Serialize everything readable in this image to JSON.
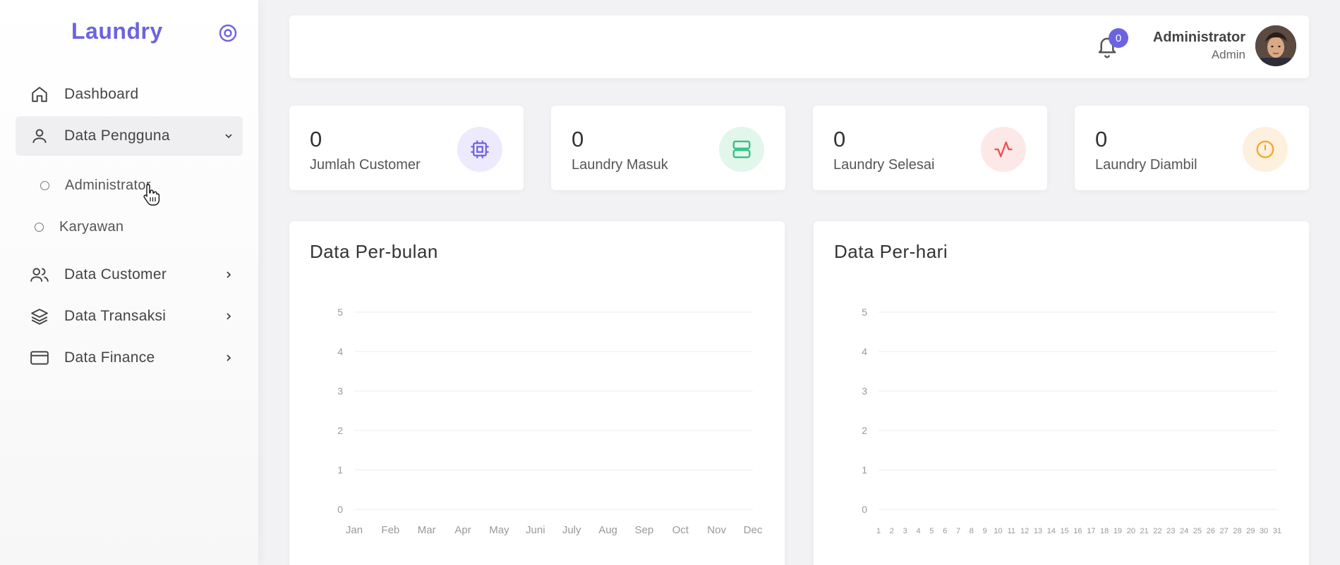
{
  "sidebar": {
    "brand": "Laundry",
    "items": [
      {
        "label": "Dashboard",
        "icon": "home-icon"
      },
      {
        "label": "Data Pengguna",
        "icon": "user-icon",
        "expanded": true,
        "children": [
          {
            "label": "Administrator"
          },
          {
            "label": "Karyawan"
          }
        ]
      },
      {
        "label": "Data Customer",
        "icon": "users-icon"
      },
      {
        "label": "Data Transaksi",
        "icon": "layers-icon"
      },
      {
        "label": "Data Finance",
        "icon": "credit-card-icon"
      }
    ]
  },
  "header": {
    "notification_count": "0",
    "user_name": "Administrator",
    "user_role": "Admin"
  },
  "stats": [
    {
      "value": "0",
      "label": "Jumlah Customer",
      "icon": "cpu-icon",
      "color": "#6c63e0",
      "bg": "#eeeafd"
    },
    {
      "value": "0",
      "label": "Laundry Masuk",
      "icon": "server-icon",
      "color": "#2bbf7e",
      "bg": "#e2f6ec"
    },
    {
      "value": "0",
      "label": "Laundry Selesai",
      "icon": "activity-icon",
      "color": "#ef4b4b",
      "bg": "#fde8e8"
    },
    {
      "value": "0",
      "label": "Laundry Diambil",
      "icon": "alert-circle-icon",
      "color": "#f5a623",
      "bg": "#fef0df"
    }
  ],
  "chart_data": [
    {
      "type": "line",
      "title": "Data Per-bulan",
      "categories": [
        "Jan",
        "Feb",
        "Mar",
        "Apr",
        "May",
        "Juni",
        "July",
        "Aug",
        "Sep",
        "Oct",
        "Nov",
        "Dec"
      ],
      "series": [
        {
          "values": [
            0,
            0,
            0,
            0,
            0,
            0,
            0,
            0,
            0,
            0,
            0,
            0
          ]
        }
      ],
      "ylim": [
        0,
        5
      ],
      "yticks": [
        0,
        1,
        2,
        3,
        4,
        5
      ],
      "grid": true
    },
    {
      "type": "line",
      "title": "Data Per-hari",
      "categories": [
        "1",
        "2",
        "3",
        "4",
        "5",
        "6",
        "7",
        "8",
        "9",
        "10",
        "11",
        "12",
        "13",
        "14",
        "15",
        "16",
        "17",
        "18",
        "19",
        "20",
        "21",
        "22",
        "23",
        "24",
        "25",
        "26",
        "27",
        "28",
        "29",
        "30",
        "31"
      ],
      "series": [
        {
          "values": [
            0,
            0,
            0,
            0,
            0,
            0,
            0,
            0,
            0,
            0,
            0,
            0,
            0,
            0,
            0,
            0,
            0,
            0,
            0,
            0,
            0,
            0,
            0,
            0,
            0,
            0,
            0,
            0,
            0,
            0,
            0
          ]
        }
      ],
      "ylim": [
        0,
        5
      ],
      "yticks": [
        0,
        1,
        2,
        3,
        4,
        5
      ],
      "grid": true
    }
  ],
  "colors": {
    "accent": "#6c63e0",
    "line_start": "#c084fc",
    "line_end": "#5b57d9"
  }
}
